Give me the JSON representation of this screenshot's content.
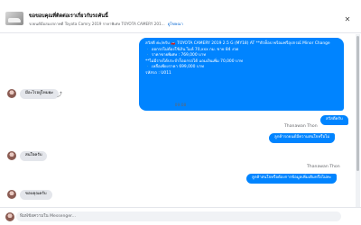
{
  "header": {
    "title": "ขอขอบคุณที่ติดต่อเราเกี่ยวกับรถคันนี้",
    "subtitle": "รถยนต์มือสองสภาพดี Toyota Camry 2019 ราคาพิเศษ TOYOTA CAMERY 201...",
    "link": "ดูโฆษณา",
    "close_icon": "close-icon"
  },
  "offer": {
    "lines": [
      "สวัสดี ค่ะ/ครับ 🚗 TOYOTA CAMERY 2019 2.5 G (MY18) AT **ตัวท็อป พร้อมฟรีอุปกรณ์ Minor Change",
      "🔹 ออกรถไม่ต้องใช้เงิน ไมล์ 70,xxx กม. ขาย 84 งวด",
      "🔹 ราคาขายพิเศษ : 769,000 บาท",
      "**ไม่มีรายได้ประจำก็ออกรถได้ แถมเงินเพิ่ม 70,000 บาท",
      "🔹 เหลือเพียงราคา 699,000 บาท",
      "รหัสรถ : U011"
    ]
  },
  "messages": {
    "in1": "มีอะไรอยู่ไหมคะ",
    "time": "09:08",
    "out1": "สวัสดีครับ",
    "sender1": "Thanawan Thon",
    "out2": "ลูกค้ารถยนต์มีความสนใจหรือไม่",
    "in2": "สนใจครับ",
    "sender2": "Thanawan Thon",
    "out3": "ลูกค้าสนใจหรือต้องการข้อมูลเพิ่มเติมหรือไม่คะ",
    "in3": "ขอบคุณครับ"
  },
  "composer": {
    "placeholder": "พิมพ์ข้อความใน Messenger..."
  }
}
